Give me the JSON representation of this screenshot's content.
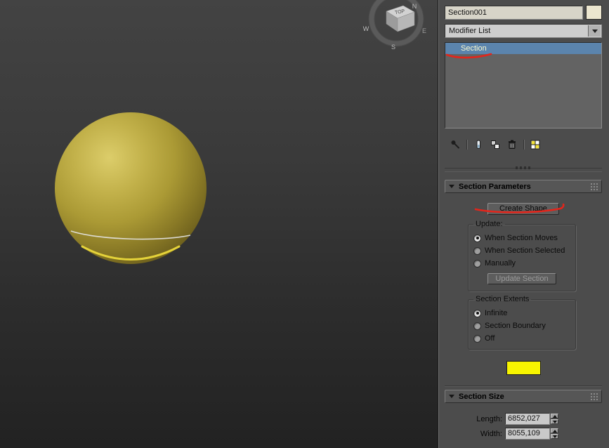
{
  "viewport": {
    "viewcube": {
      "top_face_label": "TOP",
      "compass": [
        "N",
        "E",
        "S",
        "W"
      ]
    }
  },
  "panel": {
    "object_name": "Section001",
    "modifier_list_label": "Modifier List",
    "modifier_stack": {
      "items": [
        "Section"
      ],
      "selected": "Section"
    },
    "stack_toolbar_icons": [
      "pin-stack",
      "show-end-result",
      "make-unique",
      "remove-modifier",
      "configure-modifier-sets"
    ],
    "section_parameters": {
      "title": "Section Parameters",
      "create_shape_button": "Create Shape",
      "update_group": {
        "legend": "Update:",
        "options": [
          "When Section Moves",
          "When Section Selected",
          "Manually"
        ],
        "selected": "When Section Moves",
        "update_section_button": "Update Section"
      },
      "extents_group": {
        "legend": "Section Extents",
        "options": [
          "Infinite",
          "Section Boundary",
          "Off"
        ],
        "selected": "Infinite"
      }
    },
    "section_size": {
      "title": "Section Size",
      "length_label": "Length:",
      "length_value": "6852,027",
      "width_label": "Width:",
      "width_value": "8055,109"
    }
  },
  "colors": {
    "selection_blue": "#5b84ad",
    "annotation_red": "#e3251b",
    "sphere_olive": "#b3a33c",
    "object_swatch": "#ece6cf",
    "section_swatch": "#f8f500"
  }
}
